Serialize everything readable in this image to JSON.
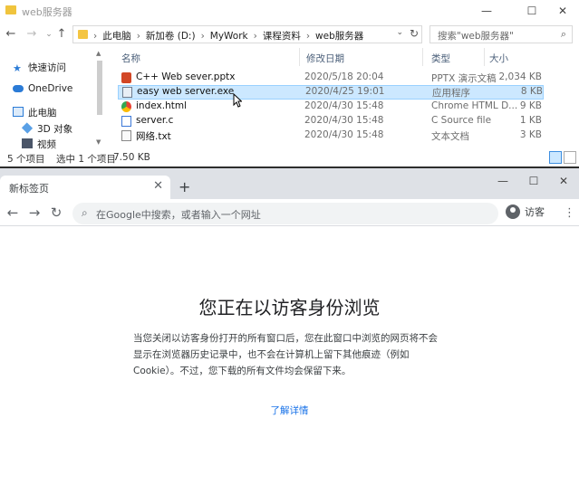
{
  "explorer": {
    "title": "web服务器",
    "window_controls": {
      "minimize": "—",
      "maximize": "☐",
      "close": "✕"
    },
    "nav": {
      "back": "←",
      "forward": "→",
      "recent": "⌄",
      "up": "↑"
    },
    "breadcrumbs": [
      "此电脑",
      "新加卷 (D:)",
      "MyWork",
      "课程资料",
      "web服务器"
    ],
    "search_placeholder": "搜索\"web服务器\"",
    "sidebar": [
      {
        "label": "快速访问",
        "icon": "star-icon"
      },
      {
        "label": "OneDrive",
        "icon": "cloud-icon"
      },
      {
        "label": "此电脑",
        "icon": "computer-icon"
      },
      {
        "label": "3D 对象",
        "icon": "cube-icon"
      },
      {
        "label": "视频",
        "icon": "video-icon"
      }
    ],
    "columns": {
      "name": "名称",
      "date": "修改日期",
      "type": "类型",
      "size": "大小"
    },
    "files": [
      {
        "name": "C++ Web sever.pptx",
        "date": "2020/5/18 20:04",
        "type": "PPTX 演示文稿",
        "size": "2,034 KB",
        "icon": "pptx-icon",
        "color": "#d24726",
        "selected": false
      },
      {
        "name": "easy web server.exe",
        "date": "2020/4/25 19:01",
        "type": "应用程序",
        "size": "8 KB",
        "icon": "exe-icon",
        "color": "#6d7b8d",
        "selected": true
      },
      {
        "name": "index.html",
        "date": "2020/4/30 15:48",
        "type": "Chrome HTML D...",
        "size": "9 KB",
        "icon": "chrome-icon",
        "color": "#1a73e8",
        "selected": false
      },
      {
        "name": "server.c",
        "date": "2020/4/30 15:48",
        "type": "C Source file",
        "size": "1 KB",
        "icon": "c-file-icon",
        "color": "#3c78d8",
        "selected": false
      },
      {
        "name": "网络.txt",
        "date": "2020/4/30 15:48",
        "type": "文本文档",
        "size": "3 KB",
        "icon": "txt-icon",
        "color": "#888888",
        "selected": false
      }
    ],
    "status": {
      "count": "5 个项目",
      "selection": "选中 1 个项目",
      "size": "7.50 KB"
    }
  },
  "browser": {
    "tab_title": "新标签页",
    "tab_close": "✕",
    "new_tab": "+",
    "window_controls": {
      "minimize": "—",
      "maximize": "☐",
      "close": "✕"
    },
    "nav": {
      "back": "←",
      "forward": "→",
      "reload": "↻"
    },
    "omnibox_placeholder": "在Google中搜索，或者输入一个网址",
    "profile_label": "访客",
    "menu": "⋮",
    "heading": "您正在以访客身份浏览",
    "description": "当您关闭以访客身份打开的所有窗口后，您在此窗口中浏览的网页将不会显示在浏览器历史记录中，也不会在计算机上留下其他痕迹（例如Cookie）。不过，您下载的所有文件均会保留下来。",
    "learn_more": "了解详情",
    "colors": {
      "link": "#1a73e8",
      "tabstrip": "#dee1e6",
      "selection": "#cce8ff"
    }
  }
}
